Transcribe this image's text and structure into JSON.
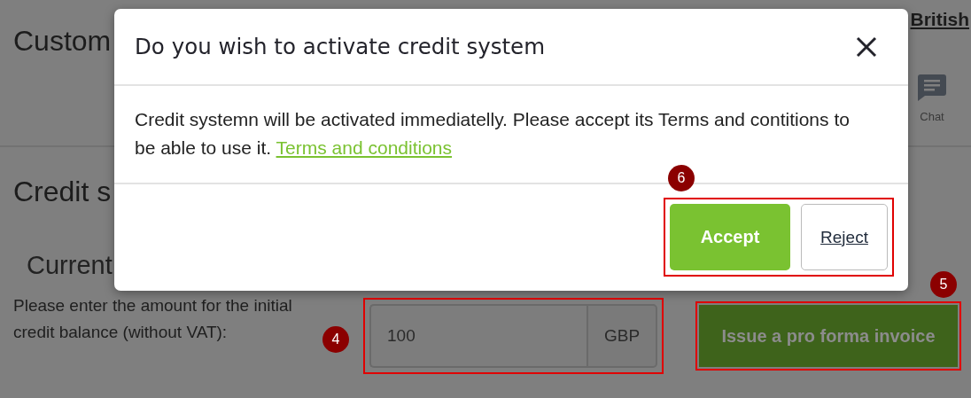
{
  "page": {
    "title": "Custom",
    "language_link": "British",
    "chat": {
      "label": "Chat"
    },
    "section_title": "Credit s",
    "subsection_title": "Current",
    "amount": {
      "label": "Please enter the amount for the initial credit balance (without VAT):",
      "value": "100",
      "currency": "GBP",
      "badge": "4"
    },
    "invoice_button": {
      "label": "Issue a pro forma invoice",
      "badge": "5"
    }
  },
  "dialog": {
    "title": "Do you wish to activate credit system",
    "message": "Credit systemn will be activated immediatelly. Please accept its Terms and contitions to be able to use it.",
    "link": "Terms and conditions",
    "badge": "6",
    "buttons": [
      {
        "label": "Accept",
        "kind": "primary"
      },
      {
        "label": "Reject",
        "kind": "secondary"
      }
    ]
  }
}
